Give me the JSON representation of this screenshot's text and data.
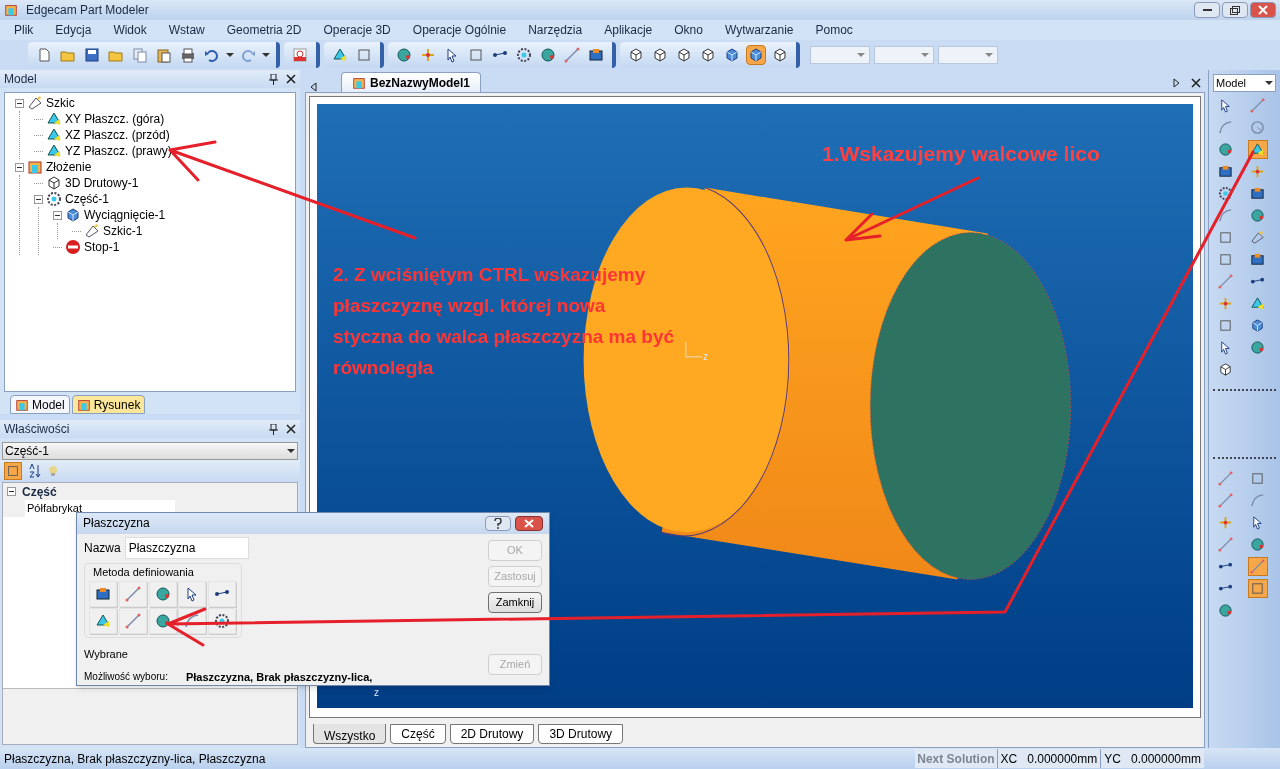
{
  "window": {
    "title": "Edgecam Part Modeler"
  },
  "menu": [
    "Plik",
    "Edycja",
    "Widok",
    "Wstaw",
    "Geometria 2D",
    "Operacje 3D",
    "Operacje Ogólnie",
    "Narzędzia",
    "Aplikacje",
    "Okno",
    "Wytwarzanie",
    "Pomoc"
  ],
  "toolbar": {
    "view_modes": [
      {
        "selected": false
      },
      {
        "selected": false
      },
      {
        "selected": false
      },
      {
        "selected": false
      },
      {
        "selected": false
      },
      {
        "selected": true
      },
      {
        "selected": false
      }
    ]
  },
  "model_panel": {
    "title": "Model",
    "tree": [
      {
        "label": "Szkic",
        "kind": "sketch",
        "expanded": true,
        "children": [
          {
            "label": "XY Płaszcz. (góra)",
            "kind": "plane"
          },
          {
            "label": "XZ Płaszcz. (przód)",
            "kind": "plane"
          },
          {
            "label": "YZ Płaszcz. (prawy)",
            "kind": "plane"
          }
        ]
      },
      {
        "label": "Złożenie",
        "kind": "assembly",
        "expanded": true,
        "children": [
          {
            "label": "3D Drutowy-1",
            "kind": "wireframe"
          },
          {
            "label": "Część-1",
            "kind": "part",
            "expanded": true,
            "children": [
              {
                "label": "Wyciągnięcie-1",
                "kind": "extrude",
                "expanded": true,
                "children": [
                  {
                    "label": "Szkic-1",
                    "kind": "sketch_item"
                  }
                ]
              },
              {
                "label": "Stop-1",
                "kind": "stop"
              }
            ]
          }
        ]
      }
    ],
    "tabs": [
      {
        "label": "Model",
        "selected": true
      },
      {
        "label": "Rysunek",
        "selected": false
      }
    ]
  },
  "properties": {
    "title": "Właściwości",
    "object": "Część-1",
    "category": "Część",
    "rows": [
      {
        "name": "Półfabrykat"
      }
    ]
  },
  "document_tab": {
    "label": "BezNazwyModel1"
  },
  "viewport": {
    "axis_labels": [
      "z",
      "z"
    ],
    "annotations": [
      "1.Wskazujemy walcowe lico",
      "2. Z wciśniętym CTRL wskazujemy płaszczyznę wzgl. której nowa styczna do walca płaszczyzna ma być równoległa"
    ]
  },
  "view_tabs": [
    {
      "label": "Wszystko",
      "selected": true
    },
    {
      "label": "Część",
      "selected": false
    },
    {
      "label": "2D Drutowy",
      "selected": false
    },
    {
      "label": "3D Drutowy",
      "selected": false
    }
  ],
  "right_toolbar": {
    "mode": "Model",
    "tools": [
      {
        "active": false
      },
      {
        "active": false
      },
      {
        "active": false
      },
      {
        "active": false
      },
      {
        "active": false
      },
      {
        "active": true
      },
      {
        "active": false
      },
      {
        "active": false
      },
      {
        "active": false
      },
      {
        "active": false
      },
      {
        "active": false
      },
      {
        "active": false
      },
      {
        "active": false
      },
      {
        "active": false
      },
      {
        "active": false
      },
      {
        "active": false
      },
      {
        "active": false
      },
      {
        "active": false
      },
      {
        "active": false
      },
      {
        "active": false
      },
      {
        "active": false
      },
      {
        "active": false
      },
      {
        "active": false
      },
      {
        "active": false
      },
      {
        "active": false
      }
    ],
    "snap_tools": [
      {
        "active": false
      },
      {
        "active": false
      },
      {
        "active": false
      },
      {
        "active": false
      },
      {
        "active": false
      },
      {
        "active": false
      },
      {
        "active": false
      },
      {
        "active": false
      },
      {
        "active": false
      },
      {
        "active": true
      },
      {
        "active": false
      },
      {
        "active": true
      },
      {
        "active": false
      }
    ]
  },
  "dialog": {
    "title": "Płaszczyzna",
    "name_label": "Nazwa",
    "name_value": "Płaszczyzna",
    "method_group": "Metoda definiowania",
    "buttons": [
      {
        "label": "OK",
        "disabled": true
      },
      {
        "label": "Zastosuj",
        "disabled": true
      },
      {
        "label": "Zamknij",
        "disabled": false
      }
    ],
    "selected_label": "Wybrane",
    "choice_label": "Możliwość wyboru:",
    "choice_value": "Płaszczyzna, Brak płaszczyzny-lica,",
    "change_button": {
      "label": "Zmień",
      "disabled": true
    }
  },
  "status_bar": {
    "message": "Płaszczyzna, Brak płaszczyzny-lica, Płaszczyzna",
    "next_solution": {
      "label": "Next Solution",
      "disabled": true
    },
    "fields": [
      {
        "label": "XC",
        "value": "0.000000mm"
      },
      {
        "label": "YC",
        "value": "0.000000mm"
      }
    ]
  }
}
